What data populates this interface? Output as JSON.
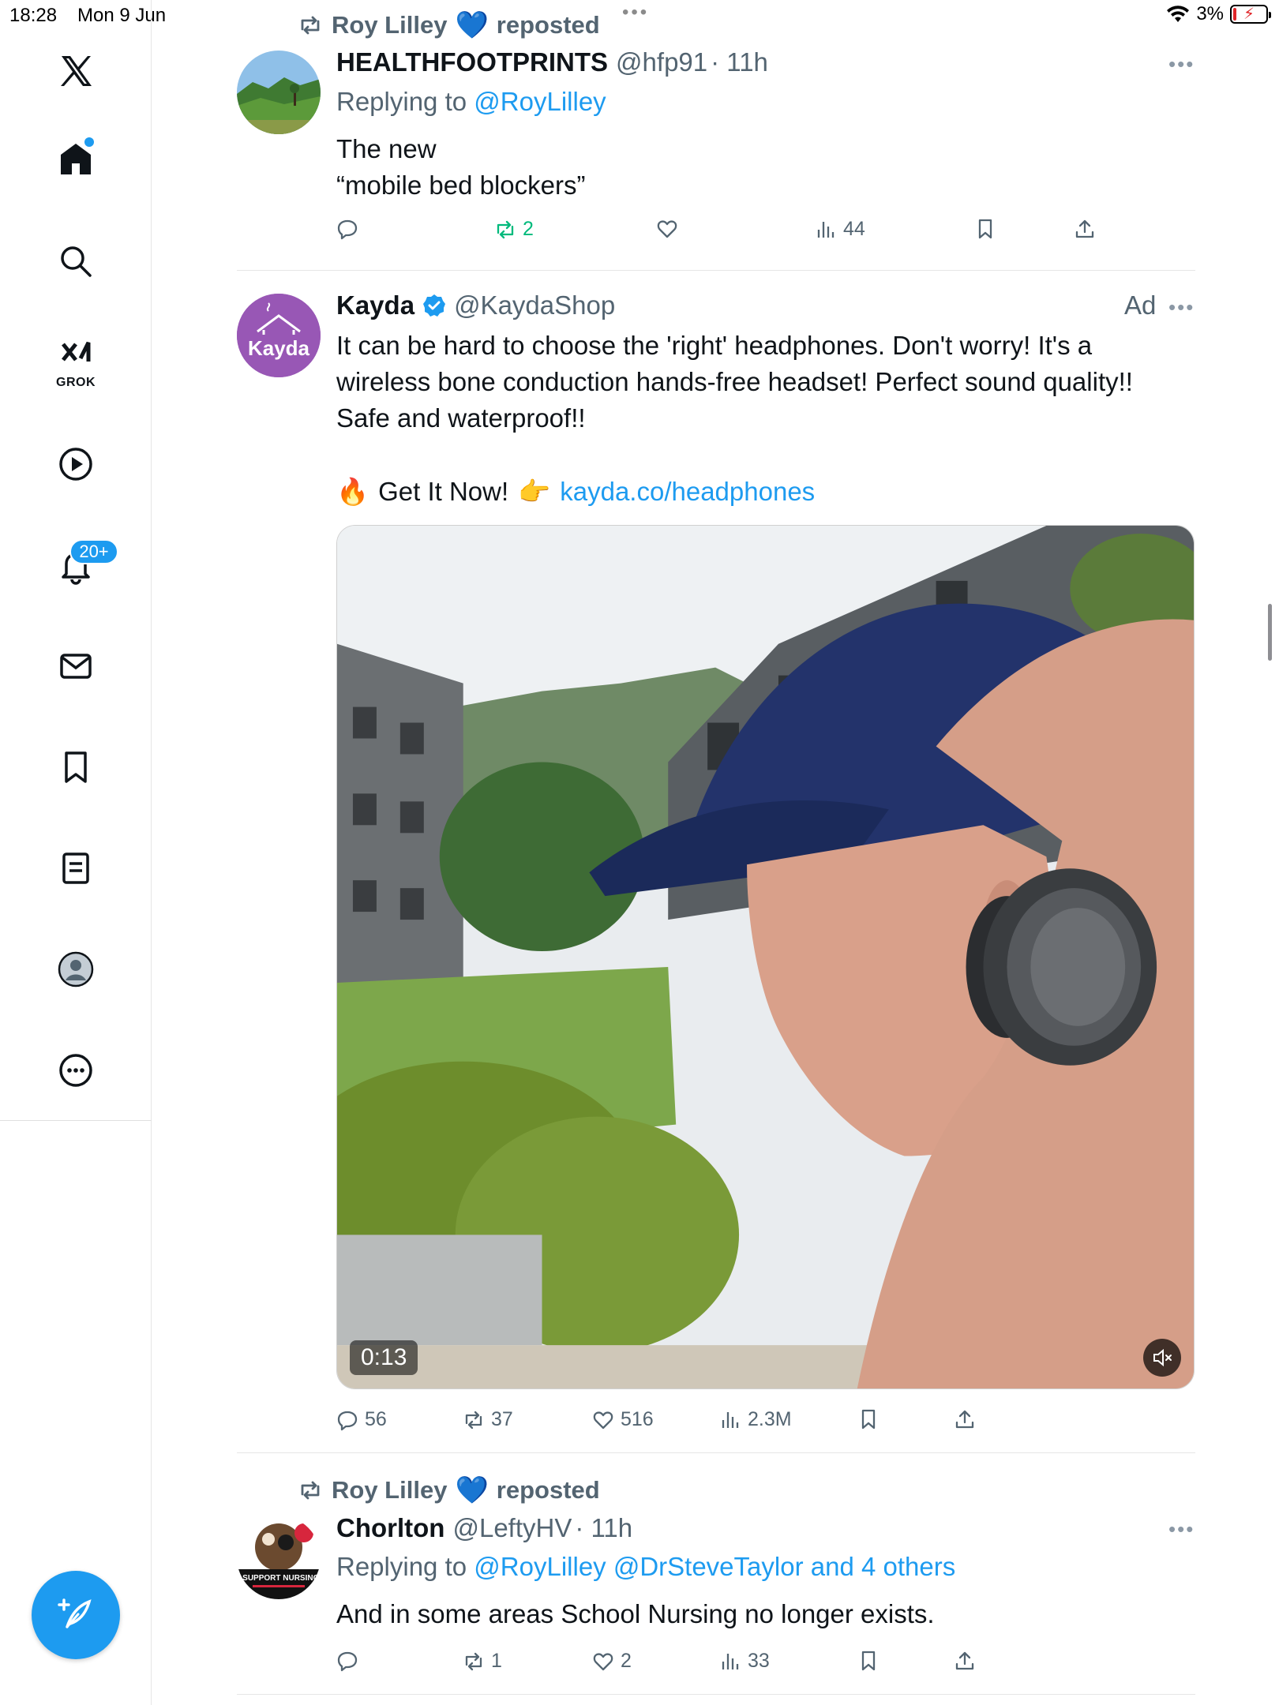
{
  "status_bar": {
    "time": "18:28",
    "date": "Mon 9 Jun",
    "battery": "3%"
  },
  "sidebar": {
    "grok_label": "GROK",
    "notifications_badge": "20+"
  },
  "tweets": [
    {
      "repost_by": "Roy Lilley",
      "repost_suffix": "reposted",
      "display_name": "HEALTHFOOTPRINTS",
      "handle": "@hfp91",
      "time": "· 11h",
      "replying_to_prefix": "Replying to",
      "replying_to": "@RoyLilley",
      "text_line1": "The new",
      "text_line2": "“mobile bed blockers”",
      "stats": {
        "replies": "",
        "reposts": "2",
        "likes": "",
        "views": "44"
      }
    },
    {
      "display_name": "Kayda",
      "handle": "@KaydaShop",
      "ad_label": "Ad",
      "avatar_text": "Kayda",
      "text_line1": "It can be hard to choose the 'right' headphones. Don't worry! It's a",
      "text_line2": "wireless bone conduction hands-free headset! Perfect sound quality!!",
      "text_line3": "Safe and waterproof!!",
      "cta_fire": "🔥",
      "cta_text": "Get It Now!",
      "cta_point": "👉",
      "cta_link": "kayda.co/headphones",
      "video_time": "0:13",
      "stats": {
        "replies": "56",
        "reposts": "37",
        "likes": "516",
        "views": "2.3M"
      }
    },
    {
      "repost_by": "Roy Lilley",
      "repost_suffix": "reposted",
      "display_name": "Chorlton",
      "handle": "@LeftyHV",
      "time": "· 11h",
      "replying_to_prefix": "Replying to",
      "replying_to": "@RoyLilley @DrSteveTaylor and 4 others",
      "text_line1": "And in some areas School Nursing no longer exists.",
      "avatar_text": "I SUPPORT NURSING",
      "stats": {
        "replies": "",
        "reposts": "1",
        "likes": "2",
        "views": "33"
      }
    }
  ],
  "colors": {
    "accent": "#1d9bf0",
    "muted": "#536471",
    "repost_green": "#00ba7c",
    "text": "#0f1419"
  }
}
